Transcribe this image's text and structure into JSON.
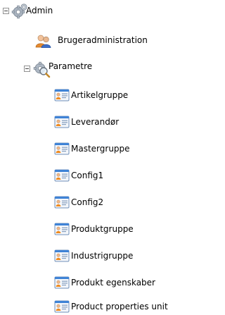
{
  "tree": {
    "root": {
      "label": "Admin",
      "icon": "gears-icon",
      "expanded": true
    },
    "user_admin": {
      "label": "Brugeradministration",
      "icon": "users-icon"
    },
    "parameters": {
      "label": "Parametre",
      "icon": "gear-search-icon",
      "expanded": true
    },
    "items": [
      {
        "label": "Artikelgruppe",
        "icon": "form-card-icon"
      },
      {
        "label": "Leverandør",
        "icon": "form-card-icon"
      },
      {
        "label": "Mastergruppe",
        "icon": "form-card-icon"
      },
      {
        "label": "Config1",
        "icon": "form-card-icon"
      },
      {
        "label": "Config2",
        "icon": "form-card-icon"
      },
      {
        "label": "Produktgruppe",
        "icon": "form-card-icon"
      },
      {
        "label": "Industrigruppe",
        "icon": "form-card-icon"
      },
      {
        "label": "Produkt egenskaber",
        "icon": "form-card-icon"
      },
      {
        "label": "Product properties unit",
        "icon": "form-card-icon"
      }
    ]
  }
}
